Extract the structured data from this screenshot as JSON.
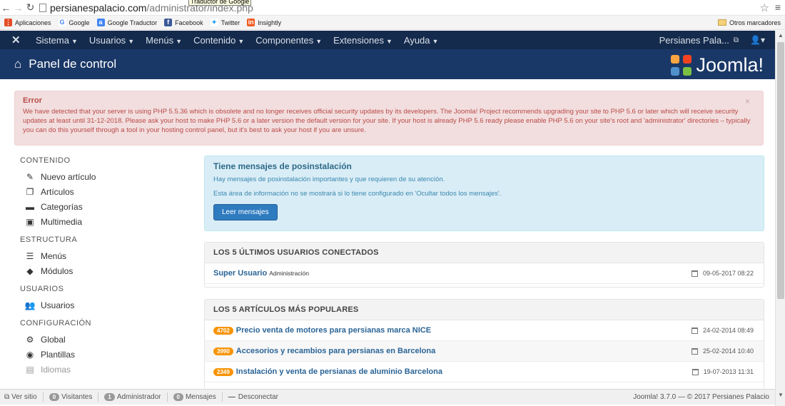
{
  "browser": {
    "url_host": "persianespalacio.com",
    "url_path": "/administrator/index.php",
    "tooltip": "Traductor de Google",
    "bookmarks": [
      {
        "label": "Aplicaciones",
        "icon": "apps-grid-icon",
        "color": "#e44d26"
      },
      {
        "label": "Google",
        "icon": "google-icon",
        "color": "#4285f4"
      },
      {
        "label": "Google Traductor",
        "icon": "translate-icon",
        "color": "#4285f4"
      },
      {
        "label": "Facebook",
        "icon": "facebook-icon",
        "color": "#3b5998"
      },
      {
        "label": "Twitter",
        "icon": "twitter-icon",
        "color": "#1da1f2"
      },
      {
        "label": "Insightly",
        "icon": "insightly-icon",
        "color": "#f15a22"
      }
    ],
    "other_bookmarks": "Otros marcadores"
  },
  "navbar": {
    "items": [
      "Sistema",
      "Usuarios",
      "Menús",
      "Contenido",
      "Componentes",
      "Extensiones",
      "Ayuda"
    ],
    "site_name": "Persianes Pala..."
  },
  "header": {
    "title": "Panel de control",
    "logo_text": "Joomla!"
  },
  "alert": {
    "heading": "Error",
    "message": "We have detected that your server is using PHP 5.5.36 which is obsolete and no longer receives official security updates by its developers. The Joomla! Project recommends upgrading your site to PHP 5.6 or later which will receive security updates at least until 31-12-2018. Please ask your host to make PHP 5.6 or a later version the default version for your site. If your host is already PHP 5.6 ready please enable PHP 5.6 on your site's root and 'administrator' directories – typically you can do this yourself through a tool in your hosting control panel, but it's best to ask your host if you are unsure.",
    "close": "×"
  },
  "sidebar": {
    "sections": [
      {
        "title": "CONTENIDO",
        "items": [
          {
            "label": "Nuevo artículo",
            "icon": "pencil-icon"
          },
          {
            "label": "Artículos",
            "icon": "copy-icon"
          },
          {
            "label": "Categorías",
            "icon": "folder-icon"
          },
          {
            "label": "Multimedia",
            "icon": "image-icon"
          }
        ]
      },
      {
        "title": "ESTRUCTURA",
        "items": [
          {
            "label": "Menús",
            "icon": "list-icon"
          },
          {
            "label": "Módulos",
            "icon": "cube-icon"
          }
        ]
      },
      {
        "title": "USUARIOS",
        "items": [
          {
            "label": "Usuarios",
            "icon": "users-icon"
          }
        ]
      },
      {
        "title": "CONFIGURACIÓN",
        "items": [
          {
            "label": "Global",
            "icon": "cog-icon"
          },
          {
            "label": "Plantillas",
            "icon": "eye-icon"
          },
          {
            "label": "Idiomas",
            "icon": "comments-icon"
          }
        ]
      }
    ]
  },
  "postinstall": {
    "heading": "Tiene mensajes de posinstalación",
    "line1": "Hay mensajes de posinstalación importantes y que requieren de su atención.",
    "line2": "Esta área de información no se mostrará si lo tiene configurado en 'Ocultar todos los mensajes'.",
    "button": "Leer mensajes"
  },
  "logged_users": {
    "title": "LOS 5 ÚLTIMOS USUARIOS CONECTADOS",
    "rows": [
      {
        "name": "Super Usuario",
        "sub": "Administración",
        "date": "09-05-2017 08:22"
      }
    ]
  },
  "popular": {
    "title": "LOS 5 ARTÍCULOS MÁS POPULARES",
    "rows": [
      {
        "hits": "4702",
        "title": "Precio venta de motores para persianas marca NICE",
        "date": "24-02-2014 08:49"
      },
      {
        "hits": "3990",
        "title": "Accesorios y recambios para persianas en Barcelona",
        "date": "25-02-2014 10:40"
      },
      {
        "hits": "2349",
        "title": "Instalación y venta de persianas de aluminio Barcelona",
        "date": "19-07-2013 11:31"
      }
    ]
  },
  "statusbar": {
    "view_site": "Ver sitio",
    "visitors_count": "0",
    "visitors": "Visitantes",
    "admin_count": "1",
    "admin": "Administrador",
    "messages_count": "0",
    "messages": "Mensajes",
    "logout": "Desconectar",
    "version": "Joomla! 3.7.0 — © 2017 Persianes Palacio"
  }
}
